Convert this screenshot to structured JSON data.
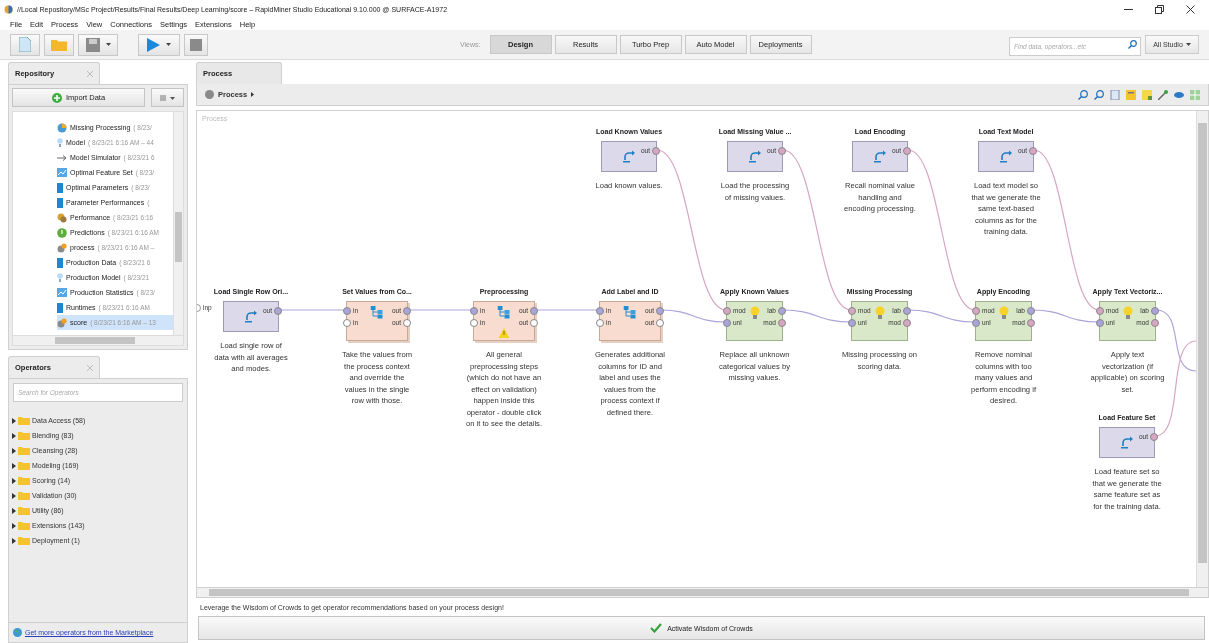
{
  "window": {
    "title": "//Local Repository/MSc Project/Results/Final Results/Deep Learning/score – RapidMiner Studio Educational 9.10.000 @ SURFACE-A1972"
  },
  "menu": [
    "File",
    "Edit",
    "Process",
    "View",
    "Connections",
    "Settings",
    "Extensions",
    "Help"
  ],
  "toolbar": {
    "views_label": "Views:",
    "views": [
      {
        "label": "Design",
        "selected": true
      },
      {
        "label": "Results",
        "selected": false
      },
      {
        "label": "Turbo Prep",
        "selected": false
      },
      {
        "label": "Auto Model",
        "selected": false
      },
      {
        "label": "Deployments",
        "selected": false
      }
    ],
    "search": {
      "placeholder": "Find data, operators...etc"
    },
    "scope": "All Studio"
  },
  "repository": {
    "tab": "Repository",
    "import_button": "Import Data",
    "items": [
      {
        "name": "Missing Processing",
        "meta": "( 8/23/",
        "kind": "preprocessing",
        "selected": false
      },
      {
        "name": "Model",
        "meta": "( 8/23/21 6:16 AM – 44",
        "kind": "model",
        "selected": false
      },
      {
        "name": "Model Simulator",
        "meta": "( 8/23/21 6",
        "kind": "simulator",
        "selected": false
      },
      {
        "name": "Optimal Feature Set",
        "meta": "( 8/23/",
        "kind": "feature-set",
        "selected": false
      },
      {
        "name": "Optimal Parameters",
        "meta": "( 8/23/",
        "kind": "data",
        "selected": false
      },
      {
        "name": "Parameter Performances",
        "meta": "(",
        "kind": "data",
        "selected": false
      },
      {
        "name": "Performance",
        "meta": "( 8/23/21 6:16",
        "kind": "performance",
        "selected": false
      },
      {
        "name": "Predictions",
        "meta": "( 8/23/21 6:16 AM",
        "kind": "prediction",
        "selected": false
      },
      {
        "name": "process",
        "meta": "( 8/23/21 6:16 AM –",
        "kind": "process",
        "selected": false
      },
      {
        "name": "Production Data",
        "meta": "( 8/23/21 6",
        "kind": "data",
        "selected": false
      },
      {
        "name": "Production Model",
        "meta": "( 8/23/21",
        "kind": "model",
        "selected": false
      },
      {
        "name": "Production Statistics",
        "meta": "( 8/23/",
        "kind": "feature-set",
        "selected": false
      },
      {
        "name": "Runtimes",
        "meta": "( 8/23/21 6:16 AM",
        "kind": "data",
        "selected": false
      },
      {
        "name": "score",
        "meta": "( 8/23/21 6:16 AM – 13",
        "kind": "process",
        "selected": true
      }
    ]
  },
  "operators": {
    "tab": "Operators",
    "search": {
      "placeholder": "Search for Operators"
    },
    "folders": [
      "Data Access (58)",
      "Blending (83)",
      "Cleansing (28)",
      "Modeling (169)",
      "Scoring (14)",
      "Validation (30)",
      "Utility (86)",
      "Extensions (143)",
      "Deployment (1)"
    ],
    "marketplace_link": "Get more operators from the Marketplace"
  },
  "process": {
    "tab": "Process",
    "breadcrumb": "Process",
    "canvas_label": "Process",
    "input_port": "inp",
    "operators": [
      {
        "title": "Load Known Values",
        "kind": "retrieve",
        "warning": false,
        "description": "Load known values.",
        "out": [
          {
            "label": "out",
            "color": "#d7a6c3"
          }
        ]
      },
      {
        "title": "Load Missing Value ...",
        "kind": "retrieve",
        "warning": false,
        "description": "Load the processing of missing values.",
        "out": [
          {
            "label": "out",
            "color": "#d7a6c3"
          }
        ]
      },
      {
        "title": "Load Encoding",
        "kind": "retrieve",
        "warning": false,
        "description": "Recall nominal value handling and encoding processing.",
        "out": [
          {
            "label": "out",
            "color": "#d7a6c3"
          }
        ]
      },
      {
        "title": "Load Text Model",
        "kind": "retrieve",
        "warning": false,
        "description": "Load text model so that we generate the same text-based columns as for the training data.",
        "out": [
          {
            "label": "out",
            "color": "#d7a6c3"
          }
        ]
      },
      {
        "title": "Load Single Row Ori...",
        "kind": "retrieve",
        "warning": false,
        "description": "Load single row of data with all averages and modes.",
        "out": [
          {
            "label": "out",
            "color": "#a9a5da"
          }
        ]
      },
      {
        "title": "Set Values from Co...",
        "kind": "subprocess",
        "warning": false,
        "description": "Take the values from the process context and override the values in the single row with those.",
        "in": [
          {
            "label": "in",
            "color": "#a9a5da"
          },
          {
            "label": "in",
            "color": "#ffffff"
          }
        ],
        "out": [
          {
            "label": "out",
            "color": "#a9a5da"
          },
          {
            "label": "out",
            "color": "#ffffff"
          }
        ]
      },
      {
        "title": "Preprocessing",
        "kind": "subprocess",
        "warning": true,
        "description": "All general preprocessing steps (which do not have an effect on validation) happen inside this operator - double click on it to see the details.",
        "in": [
          {
            "label": "in",
            "color": "#a9a5da"
          },
          {
            "label": "in",
            "color": "#ffffff"
          }
        ],
        "out": [
          {
            "label": "out",
            "color": "#a9a5da"
          },
          {
            "label": "out",
            "color": "#ffffff"
          }
        ]
      },
      {
        "title": "Add Label and ID",
        "kind": "subprocess",
        "warning": false,
        "description": "Generates additional columns for ID and label and uses the values from the process context if defined there.",
        "in": [
          {
            "label": "in",
            "color": "#a9a5da"
          },
          {
            "label": "in",
            "color": "#ffffff"
          }
        ],
        "out": [
          {
            "label": "out",
            "color": "#a9a5da"
          },
          {
            "label": "out",
            "color": "#ffffff"
          }
        ]
      },
      {
        "title": "Apply Known Values",
        "kind": "apply",
        "warning": false,
        "description": "Replace all unknown categorical values by missing values.",
        "in": [
          {
            "label": "mod",
            "color": "#d7a6c3"
          },
          {
            "label": "unl",
            "color": "#a9a5da"
          }
        ],
        "out": [
          {
            "label": "lab",
            "color": "#a9a5da"
          },
          {
            "label": "mod",
            "color": "#d7a6c3"
          }
        ]
      },
      {
        "title": "Missing Processing",
        "kind": "apply",
        "warning": false,
        "description": "Missing processing on scoring data.",
        "in": [
          {
            "label": "mod",
            "color": "#d7a6c3"
          },
          {
            "label": "unl",
            "color": "#a9a5da"
          }
        ],
        "out": [
          {
            "label": "lab",
            "color": "#a9a5da"
          },
          {
            "label": "mod",
            "color": "#d7a6c3"
          }
        ]
      },
      {
        "title": "Apply Encoding",
        "kind": "apply",
        "warning": false,
        "description": "Remove nominal columns with too many values and perform encoding if desired.",
        "in": [
          {
            "label": "mod",
            "color": "#d7a6c3"
          },
          {
            "label": "unl",
            "color": "#a9a5da"
          }
        ],
        "out": [
          {
            "label": "lab",
            "color": "#a9a5da"
          },
          {
            "label": "mod",
            "color": "#d7a6c3"
          }
        ]
      },
      {
        "title": "Apply Text Vectoriz...",
        "kind": "apply",
        "warning": false,
        "description": "Apply text vectorization (if applicable) on scoring set.",
        "in": [
          {
            "label": "mod",
            "color": "#d7a6c3"
          },
          {
            "label": "unl",
            "color": "#a9a5da"
          }
        ],
        "out": [
          {
            "label": "lab",
            "color": "#a9a5da"
          },
          {
            "label": "mod",
            "color": "#d7a6c3"
          }
        ]
      },
      {
        "title": "Load Feature Set",
        "kind": "retrieve",
        "warning": false,
        "description": "Load feature set so that we generate the same feature set as for the training data.",
        "out": [
          {
            "label": "out",
            "color": "#d7a6c3"
          }
        ]
      }
    ]
  },
  "hint": "Leverage the Wisdom of Crowds to get operator recommendations based on your process design!",
  "wisdom_button": "Activate Wisdom of Crowds"
}
